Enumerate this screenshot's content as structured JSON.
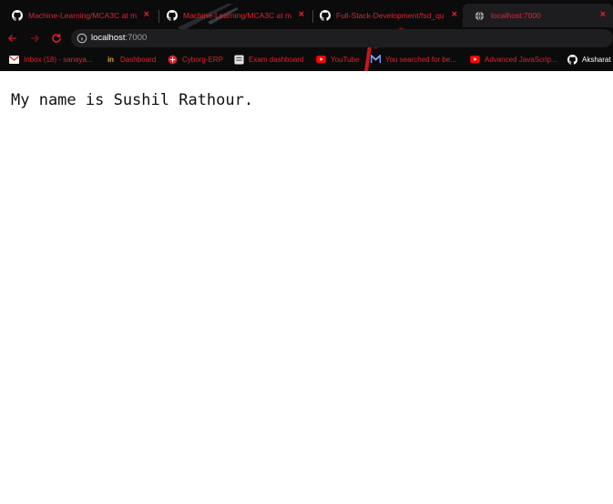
{
  "tabs": [
    {
      "title": "Machine-Learning/MCA3C at m",
      "close": "×",
      "icon": "github-icon",
      "active": false
    },
    {
      "title": "Machine-Learning/MCA3C at m",
      "close": "×",
      "icon": "github-icon",
      "active": false
    },
    {
      "title": "Full-Stack-Development/fsd_qu",
      "close": "×",
      "icon": "github-icon",
      "active": false
    },
    {
      "title": "localhost:7000",
      "close": "×",
      "icon": "globe-icon",
      "active": true
    }
  ],
  "address_bar": {
    "host": "localhost",
    "port": ":7000"
  },
  "bookmarks": [
    {
      "label": "Inbox (18) - sanaya...",
      "icon": "gmail-icon"
    },
    {
      "label": "Dashboard",
      "icon": "dashboard-icon",
      "icon_text": "in"
    },
    {
      "label": "Cyborg-ERP",
      "icon": "cyborg-icon"
    },
    {
      "label": "Exam dashboard",
      "icon": "exam-icon"
    },
    {
      "label": "YouTube",
      "icon": "youtube-icon"
    },
    {
      "label": "You searched for be...",
      "icon": "m-icon"
    },
    {
      "label": "Advanced JavaScrip...",
      "icon": "youtube-icon"
    },
    {
      "label": "Aksharat",
      "icon": "github-icon"
    }
  ],
  "page": {
    "message": "My name is Sushil Rathour."
  },
  "colors": {
    "accent": "#e0232b",
    "chrome_bg": "#0b0b0c",
    "omnibox_bg": "#1e1e21"
  }
}
